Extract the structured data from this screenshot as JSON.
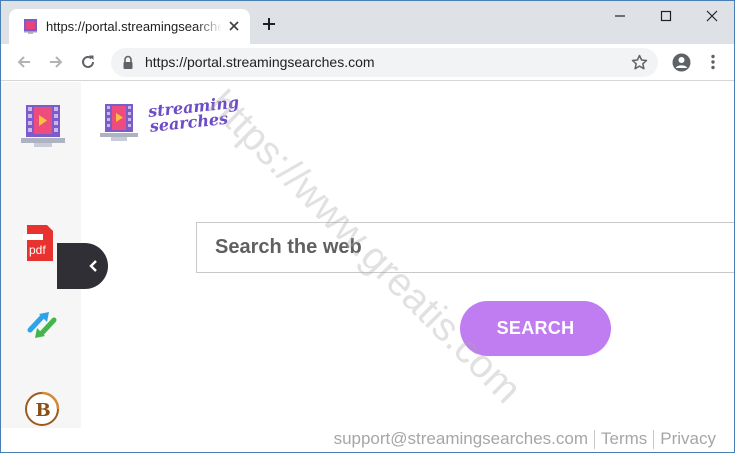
{
  "browser": {
    "tab_title": "https://portal.streamingsearches.com",
    "url": "https://portal.streamingsearches.com",
    "new_tab_icon": "plus-icon",
    "icons": [
      "back-arrow-icon",
      "forward-arrow-icon",
      "reload-icon",
      "lock-icon",
      "star-icon",
      "profile-icon",
      "kebab-menu-icon",
      "minimize-icon",
      "maximize-icon",
      "close-icon"
    ]
  },
  "page": {
    "logo_line1": "streaming",
    "logo_line2": "searches",
    "search_placeholder": "Search the web",
    "search_button": "SEARCH",
    "footer_support": "support@streamingsearches.com",
    "footer_terms": "Terms",
    "footer_privacy": "Privacy",
    "watermark": "https://www.greatis.com",
    "sidebar_items": [
      {
        "name": "streaming-tv-icon"
      },
      {
        "name": "pdf-icon",
        "label": "pdf"
      },
      {
        "name": "convert-arrows-icon"
      },
      {
        "name": "bitcoin-icon",
        "label": "B"
      }
    ]
  },
  "colors": {
    "tab_strip": "#dee1e6",
    "accent_purple": "#c07cf1",
    "logo_purple": "#6d4cc7",
    "sidebar_bg": "#f6f6f6",
    "collapse_bg": "#2f2f35",
    "footer_text": "#a6a6a6"
  }
}
